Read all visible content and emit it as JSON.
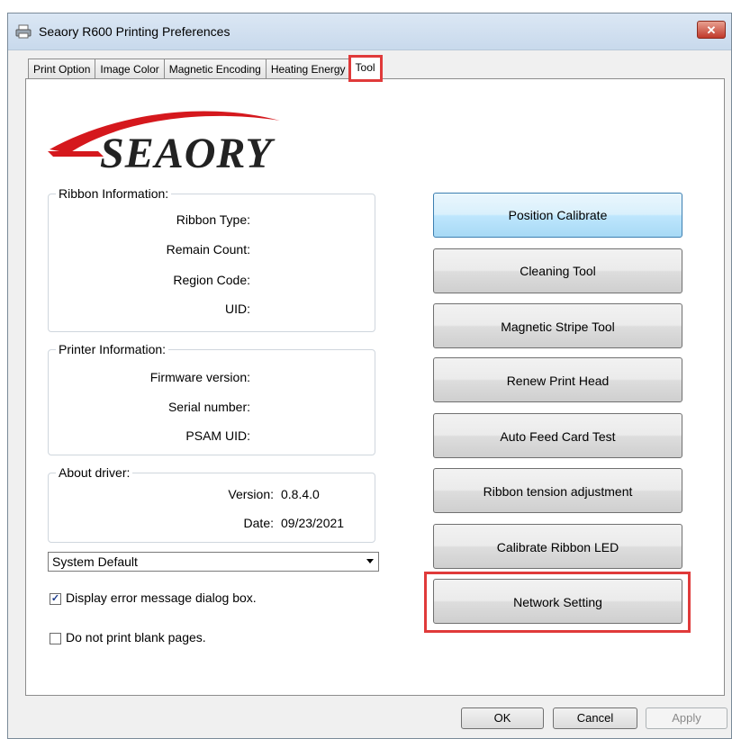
{
  "window": {
    "title": "Seaory R600 Printing Preferences",
    "close_label": "✕"
  },
  "tabs": [
    {
      "label": "Print Option"
    },
    {
      "label": "Image Color"
    },
    {
      "label": "Magnetic Encoding"
    },
    {
      "label": "Heating Energy"
    },
    {
      "label": "Tool"
    }
  ],
  "active_tab": "Tool",
  "logo": {
    "text": "SEAORY",
    "brand_color": "#d5181d",
    "text_color": "#222222"
  },
  "ribbon_info": {
    "title": "Ribbon Information:",
    "labels": [
      "Ribbon Type:",
      "Remain Count:",
      "Region Code:",
      "UID:"
    ]
  },
  "printer_info": {
    "title": "Printer Information:",
    "labels": [
      "Firmware version:",
      "Serial number:",
      "PSAM UID:"
    ]
  },
  "about_driver": {
    "title": "About driver:",
    "version_label": "Version:",
    "version_value": "0.8.4.0",
    "date_label": "Date:",
    "date_value": "09/23/2021"
  },
  "language_select": {
    "value": "System Default"
  },
  "options": {
    "display_error": {
      "label": "Display error message dialog box.",
      "checked": true
    },
    "no_blank_pages": {
      "label": "Do not print blank pages.",
      "checked": false
    }
  },
  "tools": [
    {
      "label": "Position Calibrate"
    },
    {
      "label": "Cleaning Tool"
    },
    {
      "label": "Magnetic Stripe Tool"
    },
    {
      "label": "Renew Print Head"
    },
    {
      "label": "Auto Feed Card Test"
    },
    {
      "label": "Ribbon tension adjustment"
    },
    {
      "label": "Calibrate Ribbon LED"
    },
    {
      "label": "Network Setting"
    }
  ],
  "footer": {
    "ok": "OK",
    "cancel": "Cancel",
    "apply": "Apply"
  },
  "colors": {
    "highlight": "#e03a3a",
    "focused_button": "#bee6fd"
  }
}
